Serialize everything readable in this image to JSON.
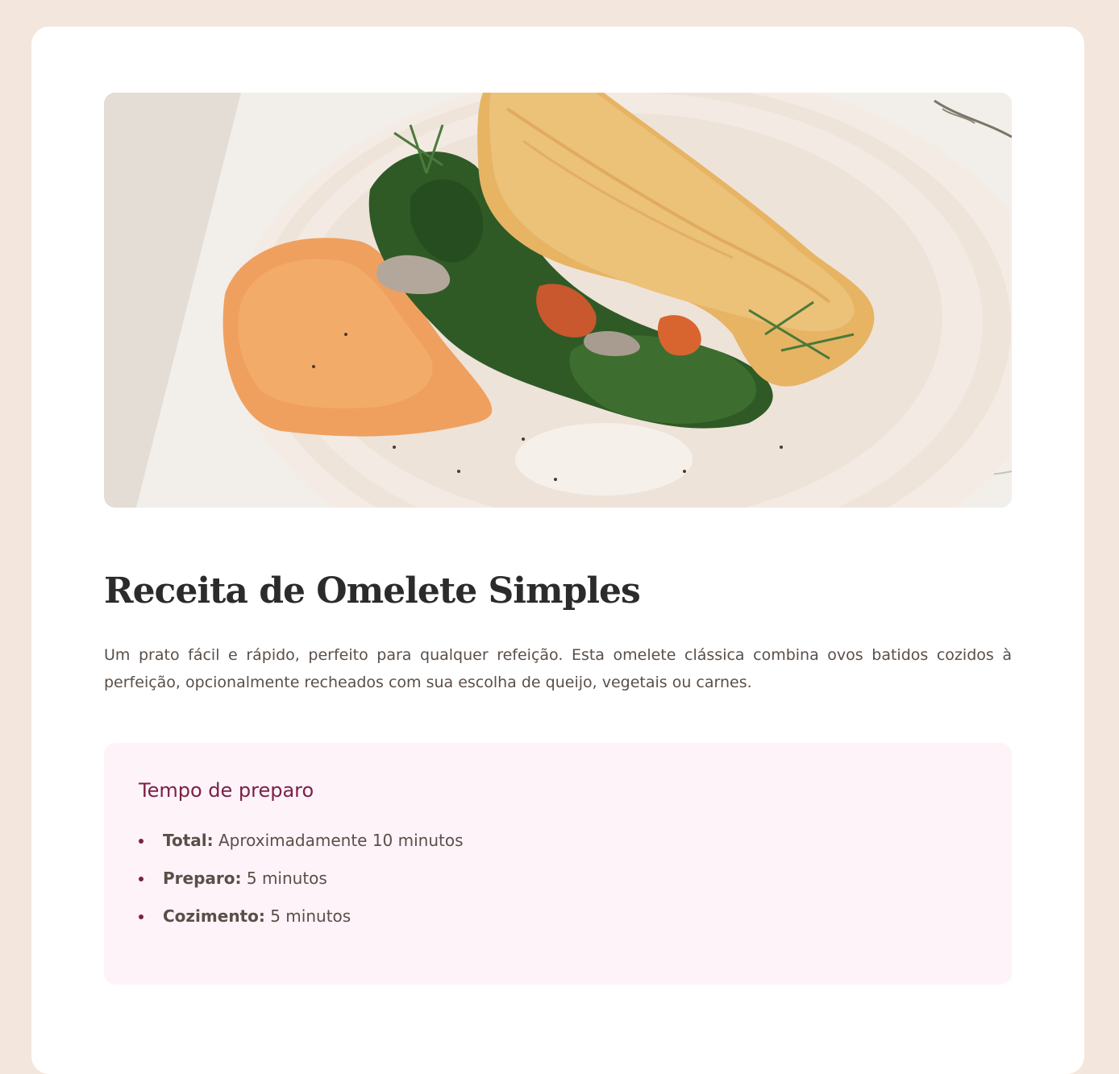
{
  "recipe": {
    "image_alt": "Omelete recheada com espinafre, cogumelos e tomate em um prato branco",
    "title": "Receita de Omelete Simples",
    "description": "Um prato fácil e rápido, perfeito para qualquer refeição. Esta omelete clássica combina ovos batidos cozidos à perfeição, opcionalmente recheados com sua escolha de queijo, vegetais ou carnes."
  },
  "preparation": {
    "title": "Tempo de preparo",
    "items": [
      {
        "label": "Total:",
        "value": " Aproximadamente 10 minutos"
      },
      {
        "label": "Preparo:",
        "value": " 5 minutos"
      },
      {
        "label": "Cozimento:",
        "value": " 5 minutos"
      }
    ]
  },
  "colors": {
    "page_background": "#f3e6dc",
    "card": "#ffffff",
    "accent": "#7a2149",
    "prep_background": "#fdf3f8",
    "text": "#5a4f48",
    "heading": "#2b2b2b"
  }
}
